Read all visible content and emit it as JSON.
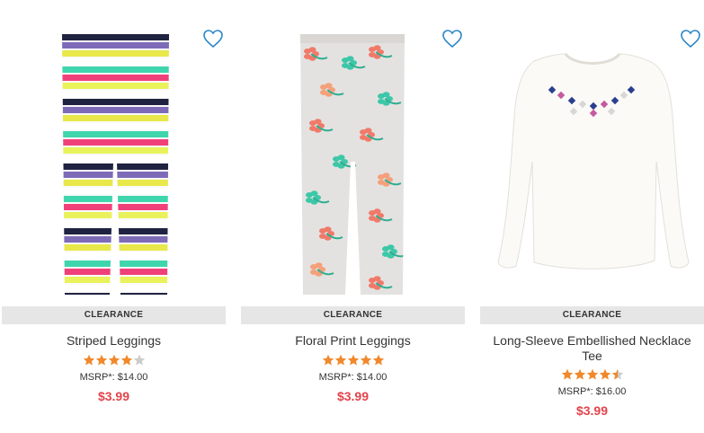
{
  "colors": {
    "badge_bg": "#e6e6e6",
    "price": "#e2434a",
    "star_filled": "#f0892b",
    "star_empty": "#cccccc",
    "heart": "#2b86c5"
  },
  "products": [
    {
      "badge": "CLEARANCE",
      "name": "Striped Leggings",
      "rating": 4,
      "msrp": "MSRP*: $14.00",
      "price": "$3.99",
      "icon": "heart-outline-icon",
      "image": "striped-leggings-image"
    },
    {
      "badge": "CLEARANCE",
      "name": "Floral Print Leggings",
      "rating": 5,
      "msrp": "MSRP*: $14.00",
      "price": "$3.99",
      "icon": "heart-outline-icon",
      "image": "floral-leggings-image"
    },
    {
      "badge": "CLEARANCE",
      "name": "Long-Sleeve Embellished Necklace Tee",
      "rating": 4.5,
      "msrp": "MSRP*: $16.00",
      "price": "$3.99",
      "icon": "heart-outline-icon",
      "image": "necklace-tee-image"
    }
  ]
}
